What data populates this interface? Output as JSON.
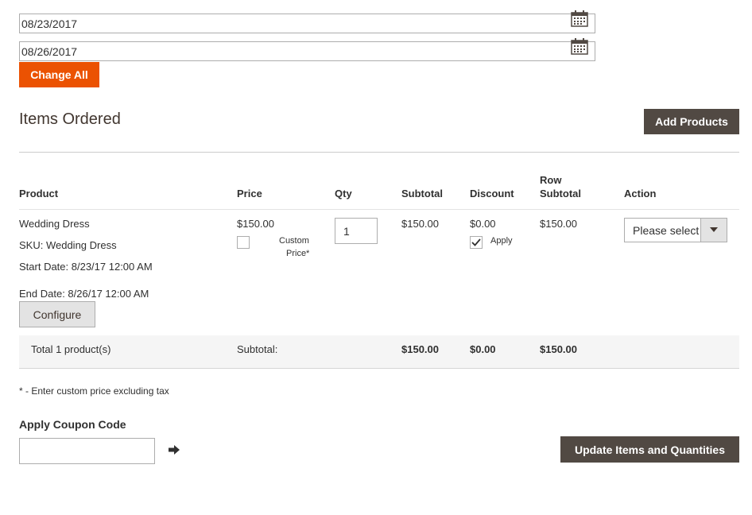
{
  "dates": {
    "from": "08/23/2017",
    "to": "08/26/2017"
  },
  "change_all_label": "Change All",
  "items_section": {
    "title": "Items Ordered",
    "add_products_label": "Add Products"
  },
  "columns": {
    "product": "Product",
    "price": "Price",
    "qty": "Qty",
    "subtotal": "Subtotal",
    "discount": "Discount",
    "row_subtotal_1": "Row",
    "row_subtotal_2": "Subtotal",
    "action": "Action"
  },
  "item": {
    "name": "Wedding Dress",
    "sku": "SKU: Wedding Dress",
    "start": "Start Date: 8/23/17 12:00 AM",
    "end": "End Date: 8/26/17 12:00 AM",
    "configure_label": "Configure",
    "price": "$150.00",
    "custom_price_1": "Custom",
    "custom_price_2": "Price*",
    "custom_price_checked": false,
    "qty": "1",
    "subtotal": "$150.00",
    "discount": "$0.00",
    "apply_label": "Apply",
    "apply_checked": true,
    "row_subtotal": "$150.00",
    "action_value": "Please select"
  },
  "totals": {
    "label": "Total 1 product(s)",
    "subtotal_label": "Subtotal:",
    "subtotal": "$150.00",
    "discount": "$0.00",
    "row_subtotal": "$150.00"
  },
  "note": "* - Enter custom price excluding tax",
  "coupon": {
    "label": "Apply Coupon Code",
    "value": ""
  },
  "update_label": "Update Items and Quantities",
  "colors": {
    "accent": "#eb5202",
    "dark_button": "#514943"
  }
}
